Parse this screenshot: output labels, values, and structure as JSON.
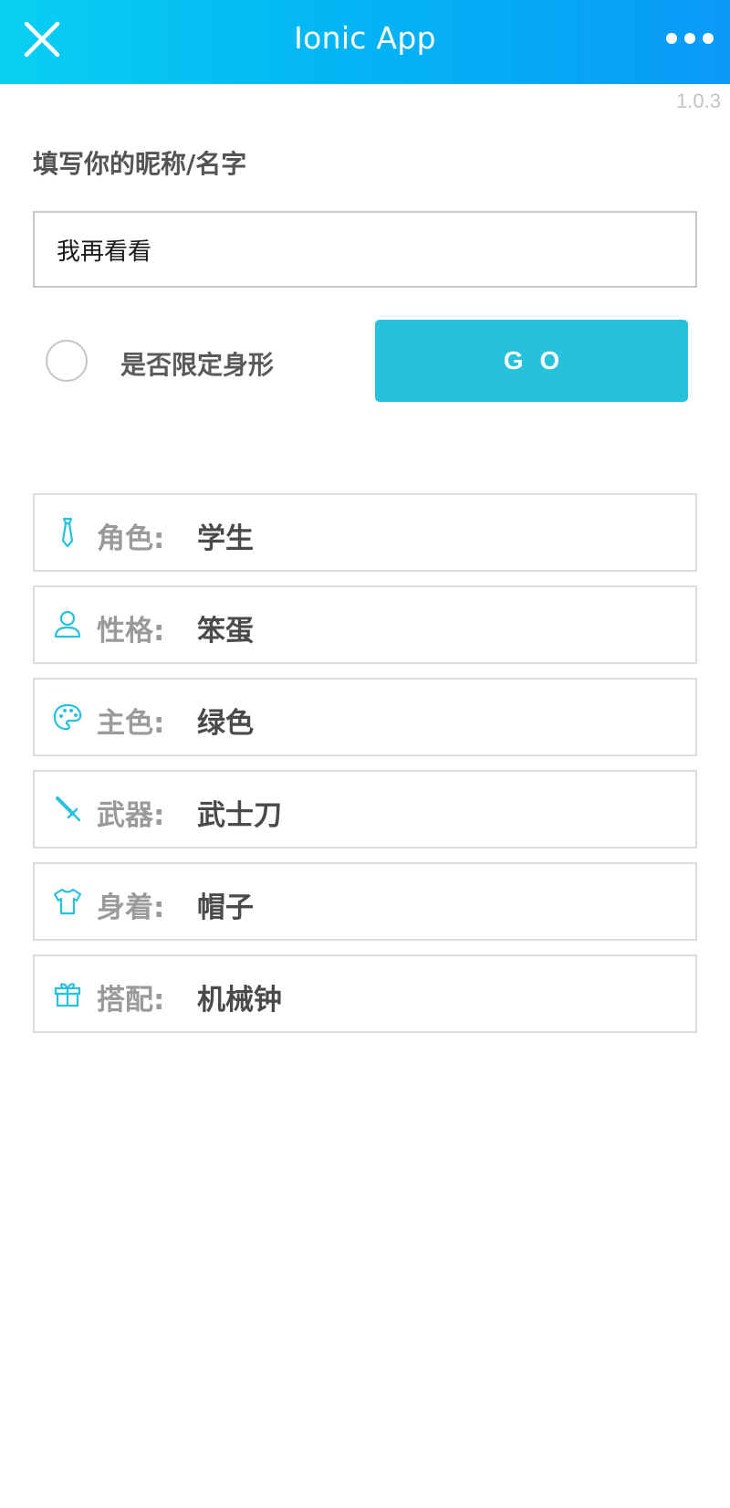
{
  "header": {
    "title": "Ionic App",
    "close_icon": "close-icon",
    "more_icon": "more-dots-icon"
  },
  "version": "1.0.3",
  "form": {
    "name_label": "填写你的昵称/名字",
    "name_value": "我再看看",
    "limit_label": "是否限定身形",
    "limit_checked": false,
    "go_label": "GO"
  },
  "colors": {
    "header_start": "#09d0f1",
    "header_end": "#0a9af8",
    "accent": "#26c2dd"
  },
  "results": [
    {
      "icon": "tie-icon",
      "key": "角色:",
      "value": "学生"
    },
    {
      "icon": "person-icon",
      "key": "性格:",
      "value": "笨蛋"
    },
    {
      "icon": "palette-icon",
      "key": "主色:",
      "value": "绿色"
    },
    {
      "icon": "sword-icon",
      "key": "武器:",
      "value": "武士刀"
    },
    {
      "icon": "shirt-icon",
      "key": "身着:",
      "value": "帽子"
    },
    {
      "icon": "gift-icon",
      "key": "搭配:",
      "value": "机械钟"
    }
  ]
}
